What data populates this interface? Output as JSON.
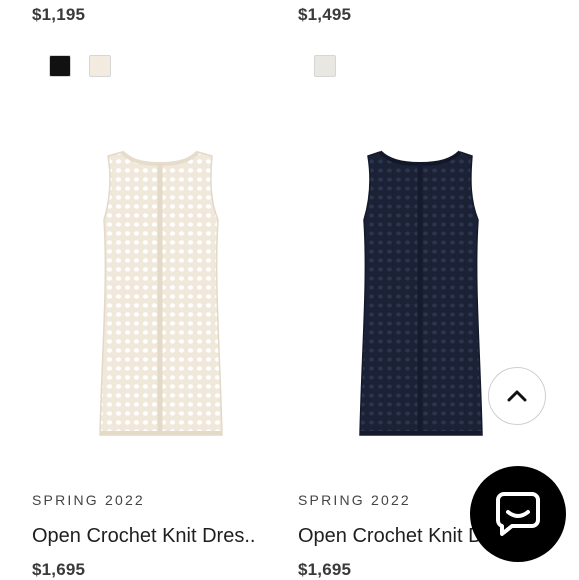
{
  "grid": {
    "top_row": [
      {
        "price": "$1,195",
        "swatches": [
          {
            "name": "black",
            "color": "#111111"
          },
          {
            "name": "ivory",
            "color": "#f3ebe0"
          }
        ]
      },
      {
        "price": "$1,495",
        "swatches": [
          {
            "name": "light-gray",
            "color": "#e9e7e2"
          }
        ]
      }
    ],
    "products": [
      {
        "season": "SPRING 2022",
        "title": "Open Crochet Knit Dres..",
        "price": "$1,695",
        "dress_color": "#efe8db"
      },
      {
        "season": "SPRING 2022",
        "title": "Open Crochet Knit D",
        "price": "$1,695",
        "dress_color": "#1b2236"
      }
    ]
  },
  "controls": {
    "scroll_top_icon": "chevron-up-icon",
    "chat_icon": "chat-bubble-icon"
  }
}
